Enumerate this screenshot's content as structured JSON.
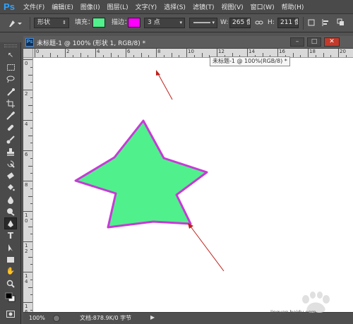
{
  "app": {
    "logo": "Ps",
    "menu": [
      "文件(F)",
      "编辑(E)",
      "图像(I)",
      "图层(L)",
      "文字(Y)",
      "选择(S)",
      "滤镜(T)",
      "视图(V)",
      "窗口(W)",
      "帮助(H)"
    ]
  },
  "options": {
    "mode": "形状",
    "fill_label": "填充：",
    "fill_color": "#50f08c",
    "stroke_label": "描边：",
    "stroke_color": "#ff00ff",
    "stroke_width": "3 点",
    "w_label": "W:",
    "w_value": "265 像",
    "link_icon": "link-icon",
    "h_label": "H:",
    "h_value": "211 像"
  },
  "document": {
    "title": "未标题-1 @ 100% (形状 1, RGB/8) *",
    "tooltip": "未标题-1 @ 100%(RGB/8) *",
    "ruler_h": [
      "0",
      "2",
      "4",
      "6",
      "8",
      "10",
      "12",
      "14",
      "16",
      "18",
      "20"
    ],
    "ruler_v": [
      "0",
      "2",
      "4",
      "6",
      "8",
      "1\n0",
      "1\n2",
      "1\n4",
      "1\n6"
    ],
    "shape_fill": "#50f08c",
    "shape_stroke": "#c73ad6"
  },
  "status": {
    "zoom": "100%",
    "doc_info": "文档:878.9K/0 字节"
  },
  "watermark": {
    "text": "jingyan.baidu.com"
  }
}
